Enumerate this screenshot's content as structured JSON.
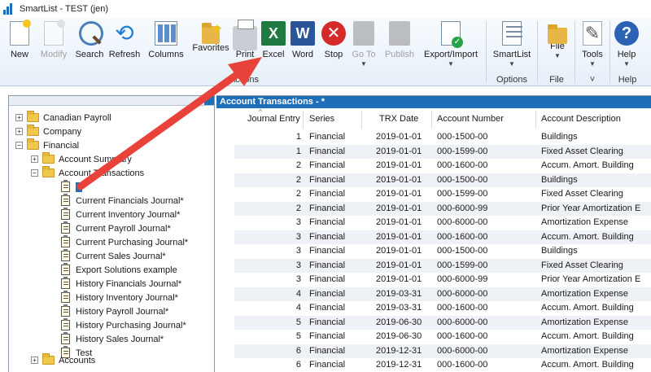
{
  "window": {
    "title": "SmartList  -  TEST (jen)"
  },
  "ribbon": {
    "buttons": {
      "new": "New",
      "modify": "Modify",
      "search": "Search",
      "refresh": "Refresh",
      "columns": "Columns",
      "favorites": "Favorites",
      "print": "Print",
      "excel": "Excel",
      "word": "Word",
      "stop": "Stop",
      "goto": "Go To",
      "publish": "Publish",
      "export": "Export/Import",
      "smartlist": "SmartList",
      "file": "File",
      "tools": "Tools",
      "help": "Help"
    },
    "groups": {
      "actions": "Actions",
      "options": "Options",
      "file": "File",
      "tools": "˅",
      "help": "Help"
    },
    "icons": {
      "excel_glyph": "X",
      "word_glyph": "W",
      "stop_glyph": "✕",
      "help_glyph": "?",
      "refresh_glyph": "⟲",
      "tools_glyph": "✎"
    }
  },
  "tree": {
    "nodes": [
      {
        "label": "Canadian Payroll",
        "toggle": "+"
      },
      {
        "label": "Company",
        "toggle": "+"
      },
      {
        "label": "Financial",
        "toggle": "−"
      },
      {
        "label": "Account Summary",
        "toggle": "+"
      },
      {
        "label": "Account Transactions",
        "toggle": "−"
      },
      {
        "label": "*"
      },
      {
        "label": "Current Financials Journal*"
      },
      {
        "label": "Current Inventory Journal*"
      },
      {
        "label": "Current Payroll Journal*"
      },
      {
        "label": "Current Purchasing Journal*"
      },
      {
        "label": "Current Sales Journal*"
      },
      {
        "label": "Export Solutions example"
      },
      {
        "label": "History Financials Journal*"
      },
      {
        "label": "History Inventory Journal*"
      },
      {
        "label": "History Payroll Journal*"
      },
      {
        "label": "History Purchasing Journal*"
      },
      {
        "label": "History Sales Journal*"
      },
      {
        "label": "Test"
      },
      {
        "label": "Accounts",
        "toggle": "+"
      }
    ]
  },
  "list": {
    "title": "Account Transactions - *",
    "columns": [
      "Journal Entry",
      "Series",
      "TRX Date",
      "Account Number",
      "Account Description"
    ],
    "rows": [
      [
        "1",
        "Financial",
        "2019-01-01",
        "000-1500-00",
        "Buildings"
      ],
      [
        "1",
        "Financial",
        "2019-01-01",
        "000-1599-00",
        "Fixed Asset Clearing"
      ],
      [
        "2",
        "Financial",
        "2019-01-01",
        "000-1600-00",
        "Accum. Amort. Building"
      ],
      [
        "2",
        "Financial",
        "2019-01-01",
        "000-1500-00",
        "Buildings"
      ],
      [
        "2",
        "Financial",
        "2019-01-01",
        "000-1599-00",
        "Fixed Asset Clearing"
      ],
      [
        "2",
        "Financial",
        "2019-01-01",
        "000-6000-99",
        "Prior Year Amortization E"
      ],
      [
        "3",
        "Financial",
        "2019-01-01",
        "000-6000-00",
        "Amortization Expense"
      ],
      [
        "3",
        "Financial",
        "2019-01-01",
        "000-1600-00",
        "Accum. Amort. Building"
      ],
      [
        "3",
        "Financial",
        "2019-01-01",
        "000-1500-00",
        "Buildings"
      ],
      [
        "3",
        "Financial",
        "2019-01-01",
        "000-1599-00",
        "Fixed Asset Clearing"
      ],
      [
        "3",
        "Financial",
        "2019-01-01",
        "000-6000-99",
        "Prior Year Amortization E"
      ],
      [
        "4",
        "Financial",
        "2019-03-31",
        "000-6000-00",
        "Amortization Expense"
      ],
      [
        "4",
        "Financial",
        "2019-03-31",
        "000-1600-00",
        "Accum. Amort. Building"
      ],
      [
        "5",
        "Financial",
        "2019-06-30",
        "000-6000-00",
        "Amortization Expense"
      ],
      [
        "5",
        "Financial",
        "2019-06-30",
        "000-1600-00",
        "Accum. Amort. Building"
      ],
      [
        "6",
        "Financial",
        "2019-12-31",
        "000-6000-00",
        "Amortization Expense"
      ],
      [
        "6",
        "Financial",
        "2019-12-31",
        "000-1600-00",
        "Accum. Amort. Building"
      ]
    ]
  },
  "colors": {
    "accent_blue": "#1f6fb8",
    "annotation_arrow": "#e8423a"
  }
}
